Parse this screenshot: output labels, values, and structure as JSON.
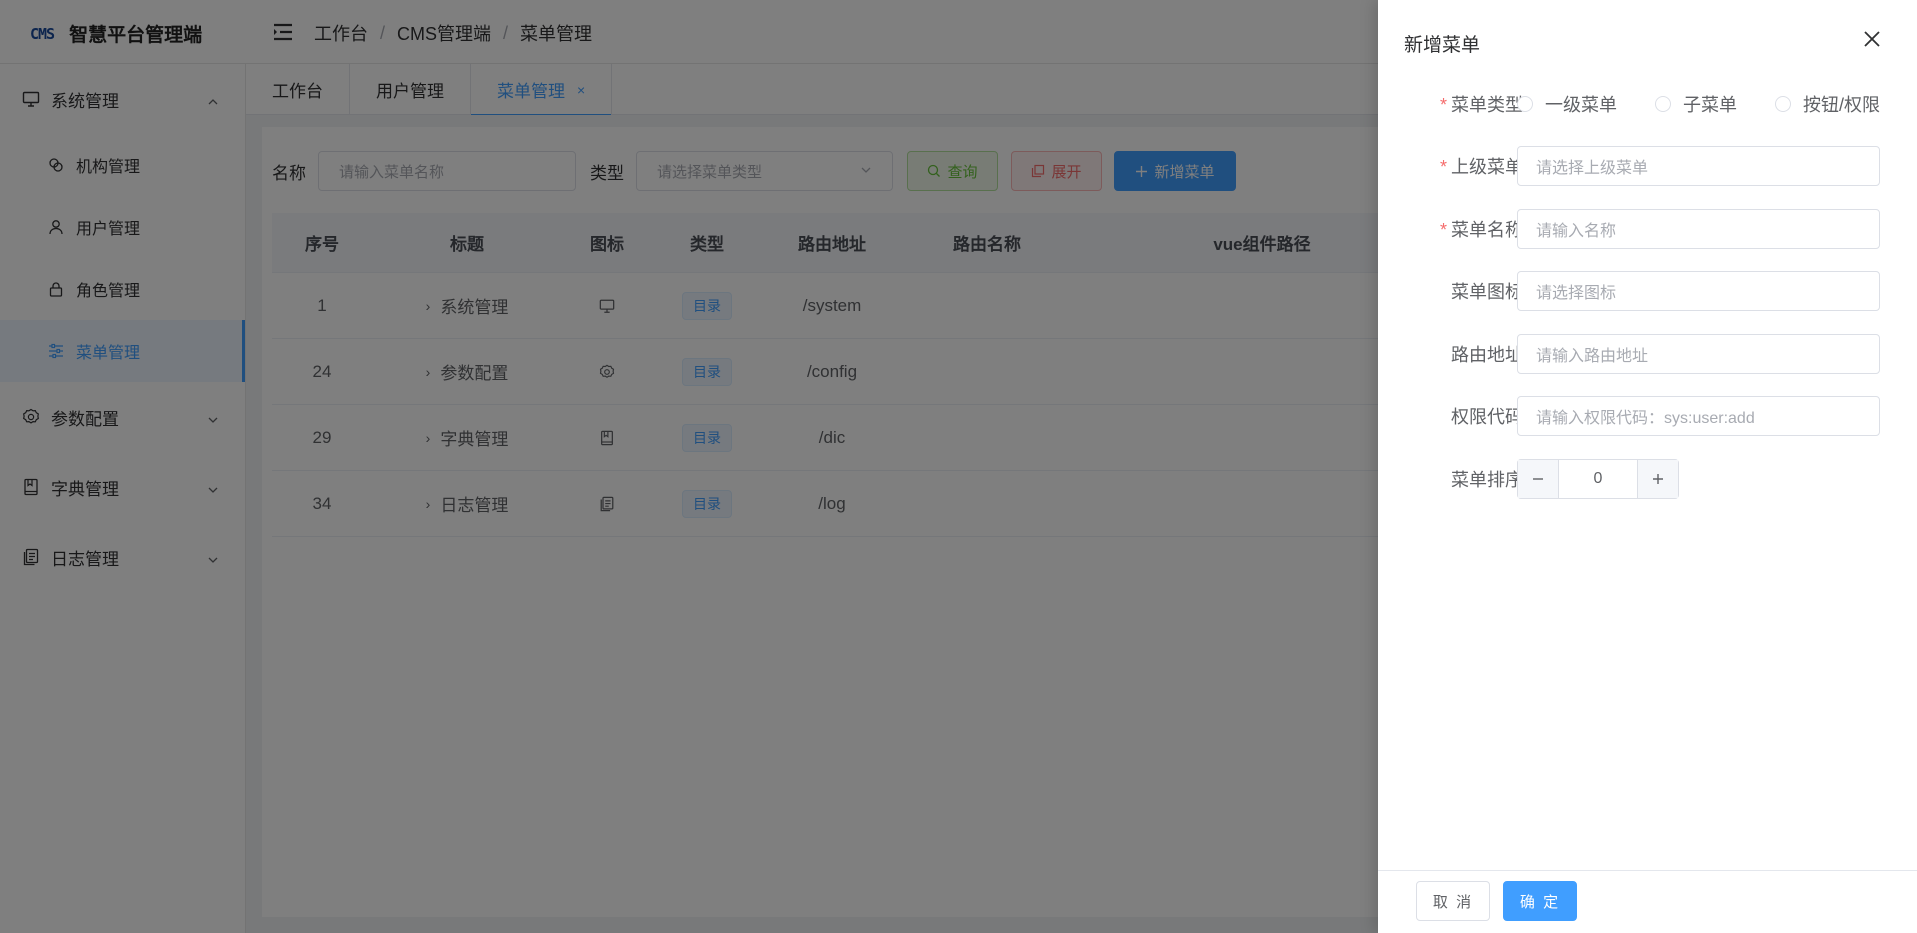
{
  "app": {
    "logo_mark": "CMS",
    "title": "智慧平台管理端"
  },
  "breadcrumb": [
    "工作台",
    "CMS管理端",
    "菜单管理"
  ],
  "breadcrumb_sep": "/",
  "sidebar": {
    "system": {
      "label": "系统管理",
      "icon": "monitor-icon"
    },
    "sub_items": [
      {
        "label": "机构管理",
        "icon": "org-icon"
      },
      {
        "label": "用户管理",
        "icon": "user-icon"
      },
      {
        "label": "角色管理",
        "icon": "lock-icon"
      },
      {
        "label": "菜单管理",
        "icon": "sliders-icon",
        "active": true
      }
    ],
    "groups": [
      {
        "label": "参数配置",
        "icon": "gear-icon"
      },
      {
        "label": "字典管理",
        "icon": "book-icon"
      },
      {
        "label": "日志管理",
        "icon": "document-icon"
      }
    ]
  },
  "tabs": [
    {
      "label": "工作台"
    },
    {
      "label": "用户管理"
    },
    {
      "label": "菜单管理",
      "active": true,
      "close": "×"
    }
  ],
  "search": {
    "name_label": "名称",
    "name_placeholder": "请输入菜单名称",
    "type_label": "类型",
    "type_placeholder": "请选择菜单类型",
    "query_label": "查询",
    "expand_label": "展开",
    "add_label": "新增菜单"
  },
  "table": {
    "headers": [
      "序号",
      "标题",
      "图标",
      "类型",
      "路由地址",
      "路由名称",
      "vue组件路径"
    ],
    "rows": [
      {
        "seq": "1",
        "title": "系统管理",
        "icon": "monitor-icon",
        "type": "目录",
        "route": "/system"
      },
      {
        "seq": "24",
        "title": "参数配置",
        "icon": "gear-icon",
        "type": "目录",
        "route": "/config"
      },
      {
        "seq": "29",
        "title": "字典管理",
        "icon": "book-icon",
        "type": "目录",
        "route": "/dic"
      },
      {
        "seq": "34",
        "title": "日志管理",
        "icon": "document-icon",
        "type": "目录",
        "route": "/log"
      }
    ]
  },
  "drawer": {
    "title": "新增菜单",
    "menu_type_label": "菜单类型",
    "menu_type_options": [
      "一级菜单",
      "子菜单",
      "按钮/权限"
    ],
    "parent_label": "上级菜单",
    "parent_placeholder": "请选择上级菜单",
    "name_label": "菜单名称",
    "name_placeholder": "请输入名称",
    "icon_label": "菜单图标",
    "icon_placeholder": "请选择图标",
    "route_label": "路由地址",
    "route_placeholder": "请输入路由地址",
    "perm_label": "权限代码",
    "perm_placeholder": "请输入权限代码：sys:user:add",
    "sort_label": "菜单排序",
    "sort_value": "0",
    "required_mark": "*",
    "cancel_label": "取 消",
    "ok_label": "确 定"
  },
  "colors": {
    "primary": "#409eff",
    "success": "#67c23a",
    "danger": "#f56c6c"
  }
}
